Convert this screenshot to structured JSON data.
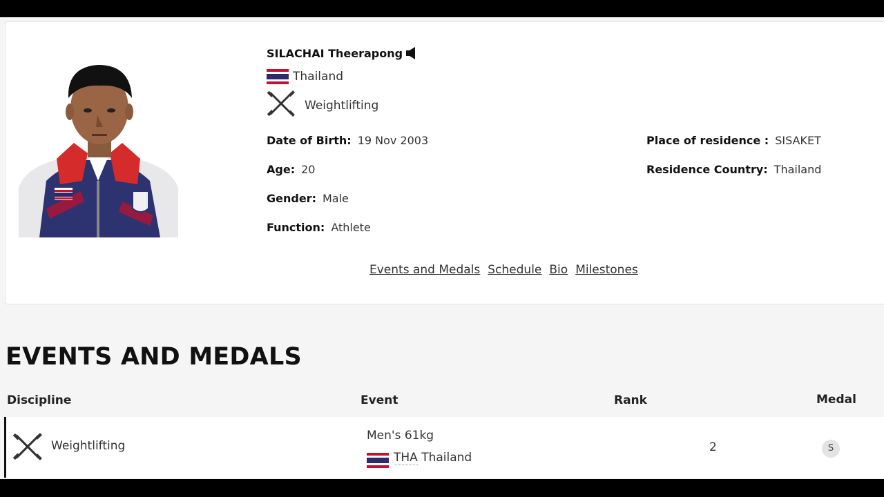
{
  "athlete": {
    "name": "SILACHAI Theerapong",
    "country": "Thailand",
    "sport": "Weightlifting",
    "fields_left": [
      {
        "label": "Date of Birth:",
        "value": "19 Nov 2003"
      },
      {
        "label": "Age:",
        "value": "20"
      },
      {
        "label": "Gender:",
        "value": "Male"
      },
      {
        "label": "Function:",
        "value": "Athlete"
      }
    ],
    "fields_right": [
      {
        "label": "Place of residence :",
        "value": "SISAKET"
      },
      {
        "label": "Residence Country:",
        "value": "Thailand"
      }
    ]
  },
  "nav_links": [
    "Events and Medals",
    "Schedule",
    "Bio",
    "Milestones"
  ],
  "events_section": {
    "title": "EVENTS AND MEDALS",
    "headers": {
      "discipline": "Discipline",
      "event": "Event",
      "rank": "Rank",
      "medal": "Medal"
    },
    "rows": [
      {
        "discipline": "Weightlifting",
        "event": "Men's 61kg",
        "noc_code": "THA",
        "noc_name": "Thailand",
        "rank": "2",
        "medal": "S"
      }
    ]
  },
  "colors": {
    "thai_red": "#c8102e",
    "thai_blue": "#2d2a6b",
    "medal_bg": "#e3e3e3"
  },
  "icons": [
    "speaker-icon",
    "thailand-flag-icon",
    "weightlifting-icon"
  ]
}
